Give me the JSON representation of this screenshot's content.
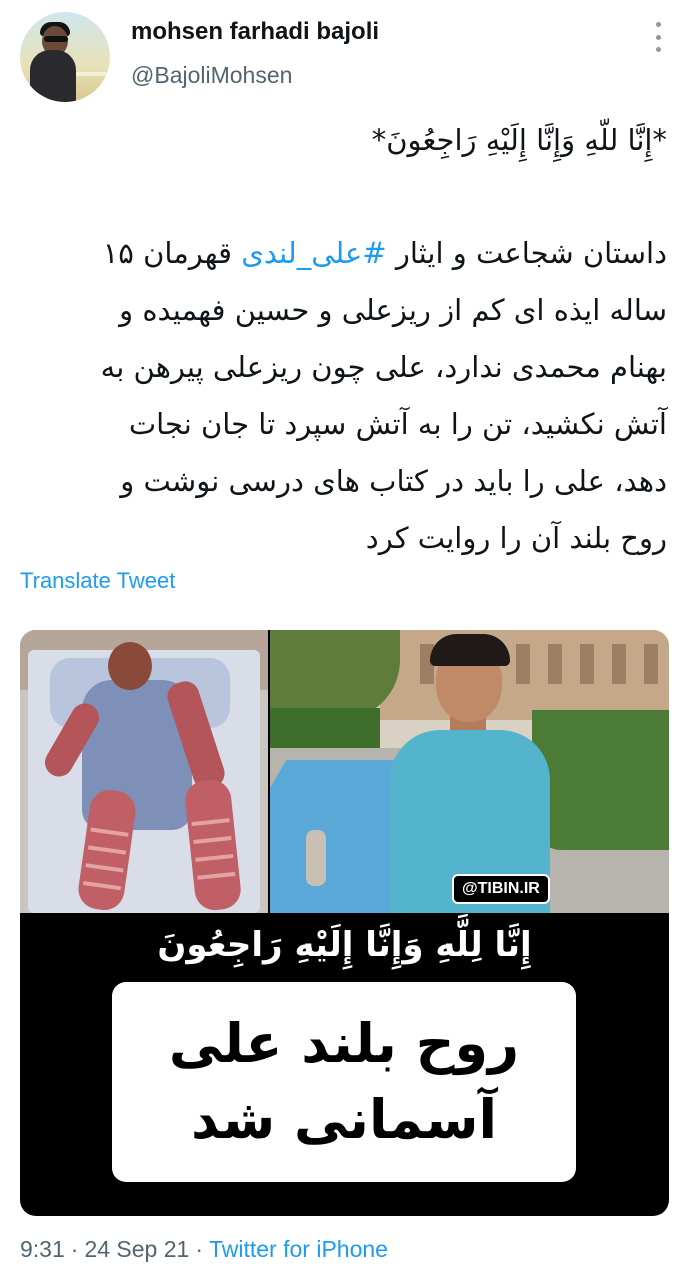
{
  "author": {
    "name": "mohsen farhadi bajoli",
    "handle": "@BajoliMohsen"
  },
  "tweet": {
    "lines": [
      "*إِنَّا للّهِ وَإِنَّا إِلَيْهِ رَاجِعُونَ*",
      "",
      "داستان شجاعت و ایثار",
      "#علی_لندی",
      "قهرمان ۱۵",
      "ساله ایذه ای کم از ریزعلی و حسین فهمیده و",
      "بهنام محمدی ندارد، علی چون ریزعلی پیرهن به",
      "آتش نکشید، تن را به آتش سپرد تا جان نجات",
      "دهد، علی را باید در کتاب های درسی نوشت و",
      "روح بلند آن را روایت کرد"
    ]
  },
  "translate_label": "Translate Tweet",
  "media": {
    "watermark": "@TIBIN.IR",
    "verse": "إِنَّا لِلَّهِ وَإِنَّا إِلَيْهِ رَاجِعُونَ",
    "box_line1": "روح بلند علی",
    "box_line2": "آسمانی شد"
  },
  "meta": {
    "time": "9:31",
    "separator": "·",
    "date": "24 Sep 21",
    "source": "Twitter for iPhone"
  },
  "colors": {
    "link": "#1d9bf0",
    "secondary_text": "#536471",
    "text": "#0f1419"
  },
  "icons": {
    "more": "more-vertical-icon"
  }
}
